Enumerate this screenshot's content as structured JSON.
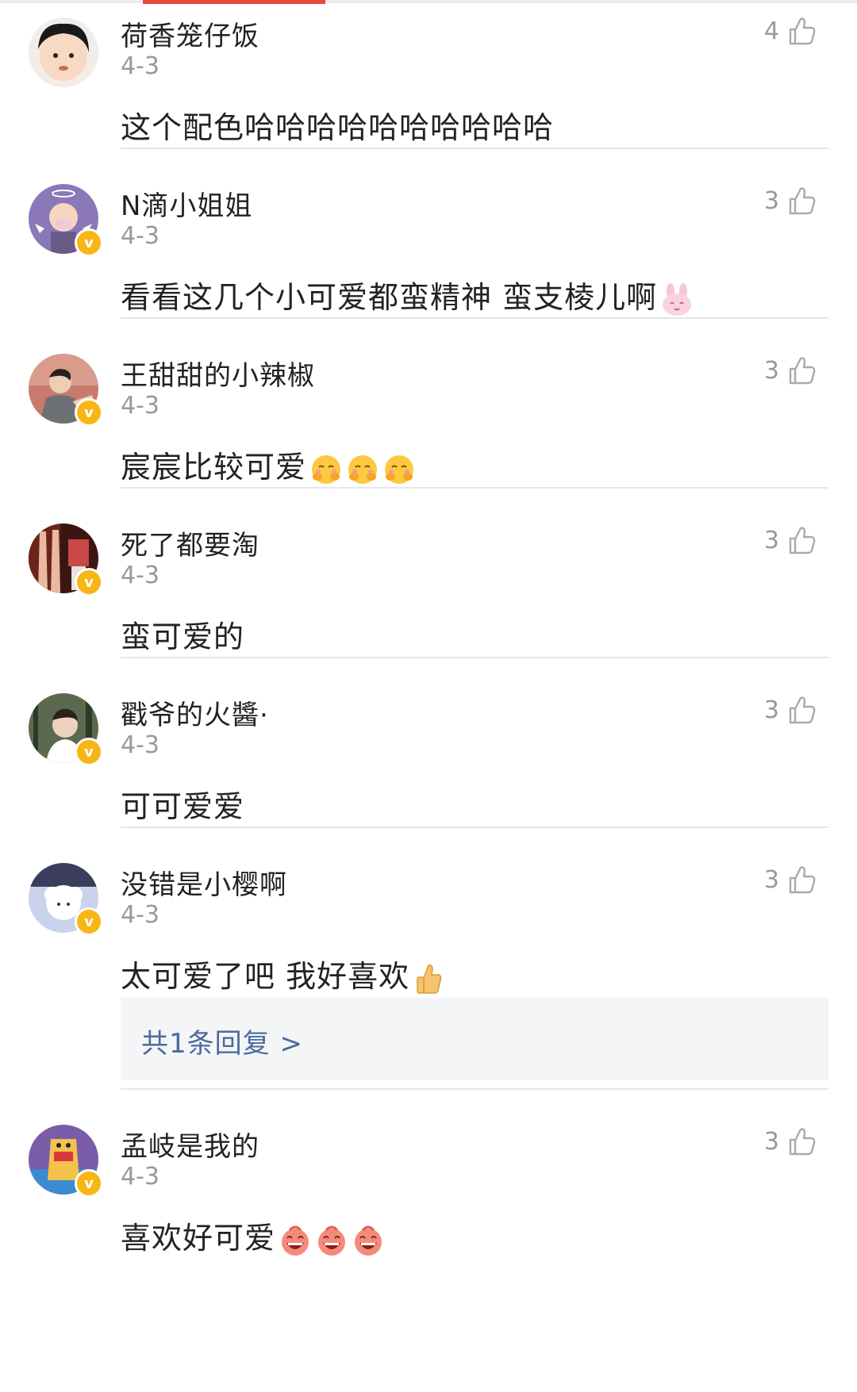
{
  "comments": [
    {
      "name": "荷香笼仔饭",
      "date": "4-3",
      "likes": "4",
      "text": "这个配色哈哈哈哈哈哈哈哈哈哈",
      "verified": false,
      "avatar_icon": "avatar-cartoon-child-icon"
    },
    {
      "name": "N滴小姐姐",
      "date": "4-3",
      "likes": "3",
      "text": "看看这几个小可爱都蛮精神  蛮支棱儿啊",
      "verified": true,
      "avatar_icon": "avatar-angel-baby-icon",
      "emoji": "bunny-emoji-icon"
    },
    {
      "name": "王甜甜的小辣椒",
      "date": "4-3",
      "likes": "3",
      "text": "宸宸比较可爱",
      "verified": true,
      "avatar_icon": "avatar-young-man-icon",
      "emoji": "hug-emoji-icon"
    },
    {
      "name": "死了都要淘",
      "date": "4-3",
      "likes": "3",
      "text": "蛮可爱的",
      "verified": true,
      "avatar_icon": "avatar-photo-icon"
    },
    {
      "name": "戳爷的火醬·",
      "date": "4-3",
      "likes": "3",
      "text": "可可爱爱",
      "verified": true,
      "avatar_icon": "avatar-man-forest-icon"
    },
    {
      "name": "没错是小樱啊",
      "date": "4-3",
      "likes": "3",
      "text": "太可爱了吧 我好喜欢",
      "verified": true,
      "avatar_icon": "avatar-cartoon-sheep-icon",
      "emoji": "thumbs-up-emoji-icon",
      "reply_label": "共1条回复 >"
    },
    {
      "name": "孟岐是我的",
      "date": "4-3",
      "likes": "3",
      "text": "喜欢好可爱",
      "verified": true,
      "avatar_icon": "avatar-cartoon-character-icon",
      "emoji": "laughing-emoji-icon"
    }
  ],
  "badge_label": "v",
  "colors": {
    "accent": "#e8493c",
    "verified": "#f7b614",
    "link": "#4a6c9e",
    "muted": "#999999"
  }
}
